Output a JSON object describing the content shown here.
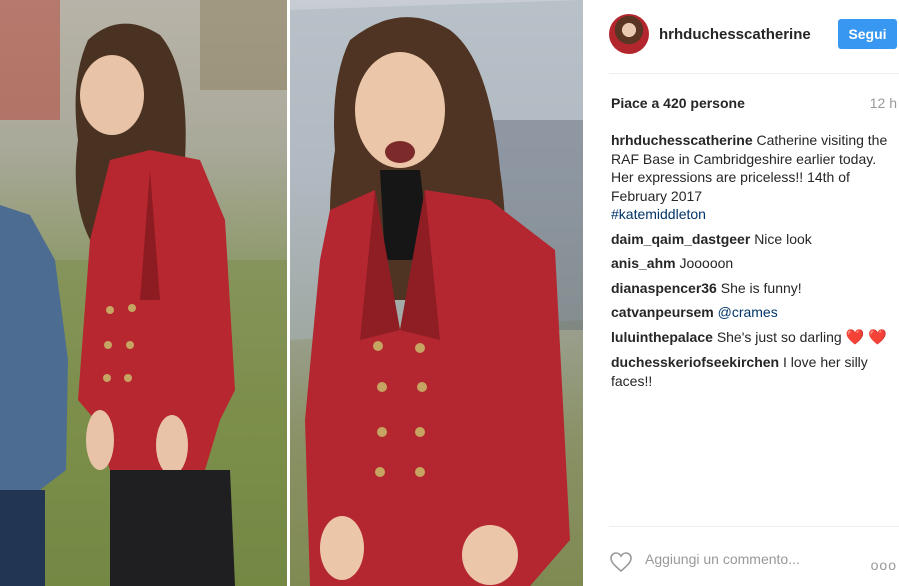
{
  "post": {
    "username": "hrhduchesscatherine",
    "follow_label": "Segui",
    "likes_text": "Piace a 420 persone",
    "time_ago": "12 h",
    "caption": {
      "username": "hrhduchesscatherine",
      "text": "Catherine visiting the RAF Base in Cambridgeshire earlier today. Her expressions are priceless!! 14th of February 2017",
      "hashtag": "#katemiddleton"
    },
    "comments": [
      {
        "username": "daim_qaim_dastgeer",
        "text": "Nice look"
      },
      {
        "username": "anis_ahm",
        "text": "Jooooon"
      },
      {
        "username": "dianaspencer36",
        "text": "She is funny!"
      },
      {
        "username": "catvanpeursem",
        "text": "@crames"
      },
      {
        "username": "luluinthepalace",
        "text": "She's just so darling",
        "emoji": "❤️ ❤️"
      },
      {
        "username": "duchesskeriofseekirchen",
        "text": "I love her silly faces!!"
      }
    ],
    "add_comment_placeholder": "Aggiungi un commento...",
    "more_label": "ooo"
  },
  "icons": {
    "like": "heart-outline-icon",
    "more": "ellipsis-icon"
  },
  "colors": {
    "follow_button": "#3897f0",
    "hashtag": "#003569",
    "muted": "#999999"
  }
}
